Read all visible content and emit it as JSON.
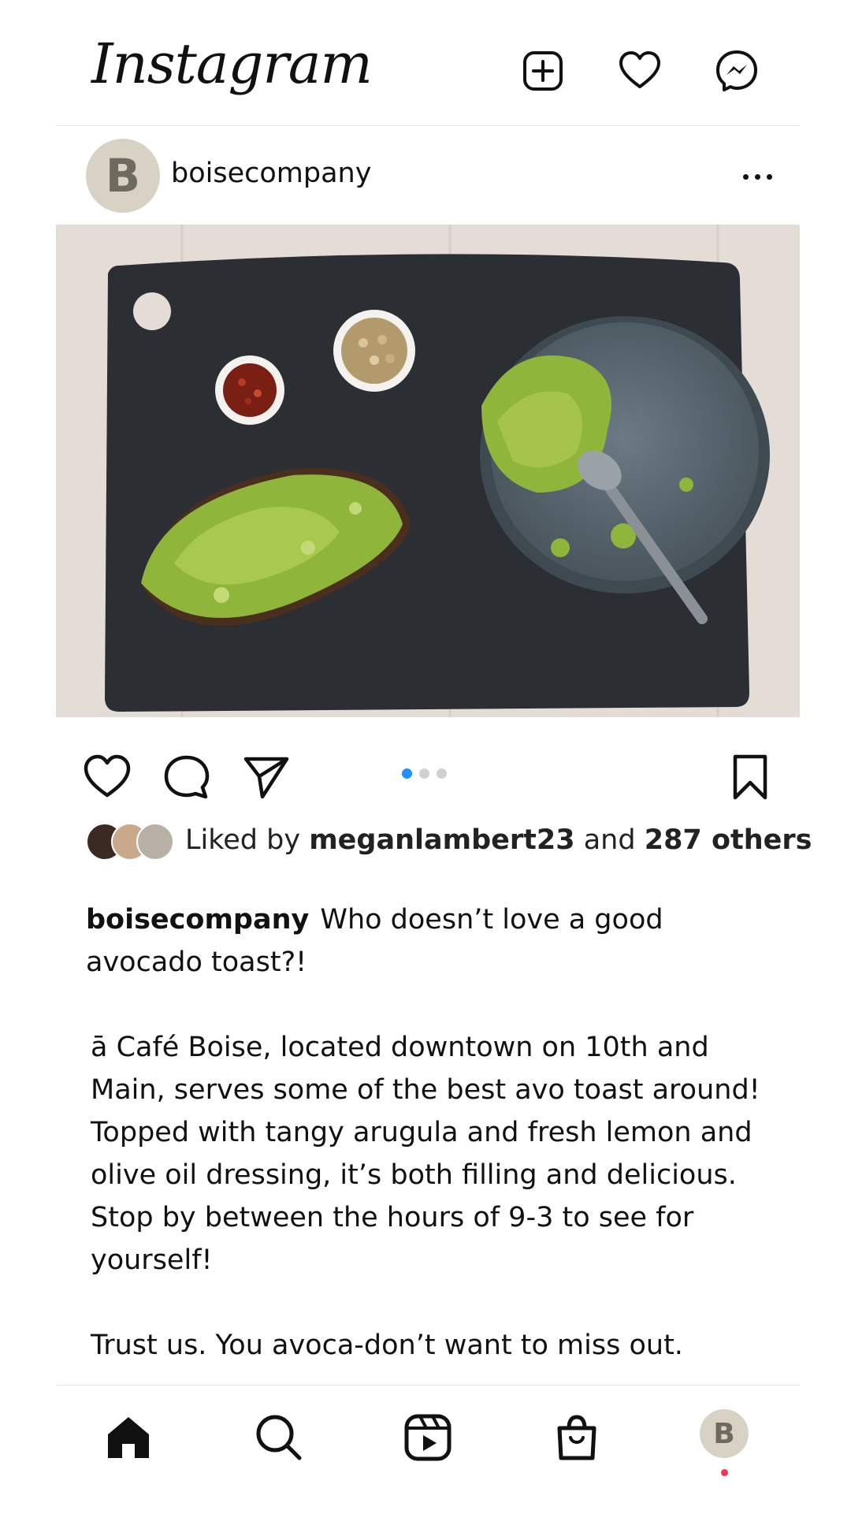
{
  "app": {
    "logo_text": "Instagram"
  },
  "header_icons": [
    "new-post-icon",
    "heart-icon",
    "messenger-icon"
  ],
  "post": {
    "username": "boisecompany",
    "avatar_letter": "B",
    "carousel": {
      "count": 3,
      "active_index": 0
    },
    "likes": {
      "prefix": "Liked by",
      "user": "meganlambert23",
      "middle": "and",
      "others": "287 others"
    },
    "caption": {
      "username": "boisecompany",
      "lines": [
        "Who doesn’t love a good avocado toast?!",
        "",
        "ā Café Boise, located downtown on 10th and Main, serves some of the best avo toast around! Topped with tangy arugula and fresh lemon and olive oil dressing, it’s both filling and delicious. Stop by between the hours of 9-3 to see for yourself!",
        "",
        "Trust us. You avoca-don’t want to miss out."
      ]
    }
  },
  "bottom_nav": {
    "items": [
      "home-icon",
      "search-icon",
      "reels-icon",
      "shop-icon",
      "profile-avatar"
    ],
    "profile_letter": "B"
  },
  "colors": {
    "accent_blue": "#1e90ff",
    "notification_red": "#ff2e55",
    "avatar_bg": "#d8d2c4"
  }
}
